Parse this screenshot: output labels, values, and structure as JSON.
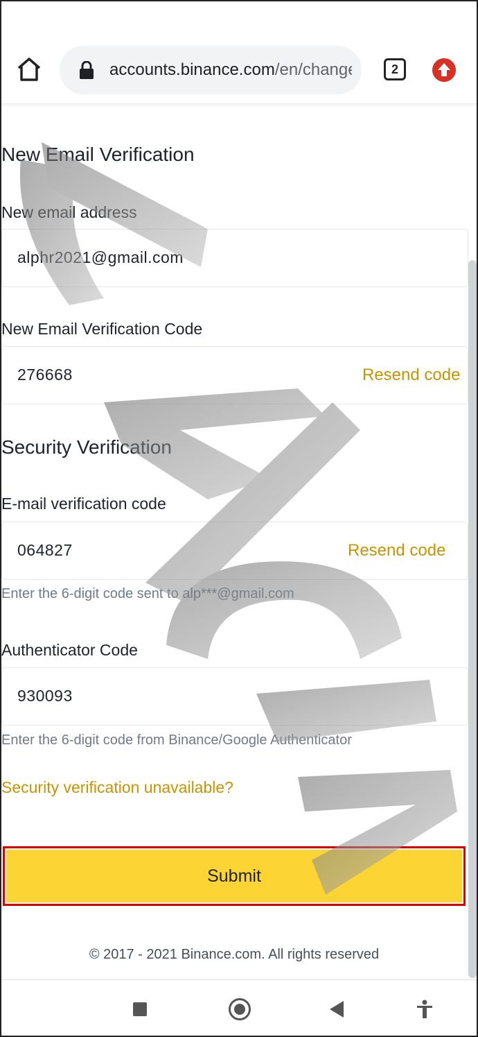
{
  "browser": {
    "url_host": "accounts.binance.com",
    "url_path": "/en/change",
    "tab_count": "2",
    "home_icon": "home-icon",
    "lock_icon": "lock-icon",
    "update_icon": "arrow-up-icon"
  },
  "form": {
    "new_email_section_title": "New Email Verification",
    "new_email_label": "New email address",
    "new_email_value": "alphr2021@gmail.com",
    "new_email_code_label": "New Email Verification Code",
    "new_email_code_value": "276668",
    "resend_label_1": "Resend code",
    "security_section_title": "Security Verification",
    "email_code_label": "E-mail verification code",
    "email_code_value": "064827",
    "resend_label_2": "Resend code",
    "email_code_hint": "Enter the 6-digit code sent to alp***@gmail.com",
    "auth_code_label": "Authenticator Code",
    "auth_code_value": "930093",
    "auth_code_hint": "Enter the 6-digit code from Binance/Google Authenticator",
    "unavailable_link": "Security verification unavailable?",
    "submit_label": "Submit"
  },
  "footer": {
    "copyright": "© 2017 - 2021 Binance.com. All rights reserved"
  },
  "nav": {
    "recents_icon": "recents-square-icon",
    "home_icon": "home-circle-icon",
    "back_icon": "back-triangle-icon",
    "accessibility_icon": "accessibility-icon"
  },
  "colors": {
    "accent": "#fcd535",
    "link": "#c99400",
    "highlight_border": "#e00000"
  }
}
